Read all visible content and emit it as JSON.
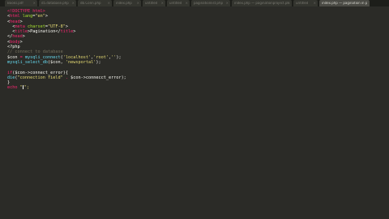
{
  "tabs": [
    {
      "label": "Books.pdf",
      "width": 40,
      "active": false
    },
    {
      "label": "d5.database.php",
      "width": 46,
      "active": false
    },
    {
      "label": "db.Conn.php",
      "width": 42,
      "active": false
    },
    {
      "label": "index.php",
      "width": 34,
      "active": false
    },
    {
      "label": "untitled",
      "width": 28,
      "active": false
    },
    {
      "label": "untitled",
      "width": 28,
      "active": false
    },
    {
      "label": "paginationlist.php",
      "width": 48,
      "active": false
    },
    {
      "label": "index.php — paginationproject.php",
      "width": 74,
      "active": false
    },
    {
      "label": "untitled",
      "width": 30,
      "active": false
    },
    {
      "label": "index.php — pagination in php",
      "width": 62,
      "active": true
    }
  ],
  "code": [
    {
      "l1": "<!DOCTYPE html>"
    },
    {
      "l2a": "<",
      "l2b": "html",
      "l2c": " lang",
      "l2d": "=",
      "l2e": "\"en\"",
      "l2f": ">"
    },
    {
      "l3a": "<",
      "l3b": "head",
      "l3c": ">"
    },
    {
      "l4a": "  <",
      "l4b": "meta",
      "l4c": " charset",
      "l4d": "=",
      "l4e": "\"UTF-8\"",
      "l4f": ">"
    },
    {
      "l5a": "  <",
      "l5b": "title",
      "l5c": ">",
      "l5d": "Pagination",
      "l5e": "</",
      "l5f": "title",
      "l5g": ">"
    },
    {
      "l6a": "</",
      "l6b": "head",
      "l6c": ">"
    },
    {
      "l7a": "<",
      "l7b": "body",
      "l7c": ">"
    },
    {
      "l8": "<?php"
    },
    {
      "l9": "// connect to database"
    },
    {
      "l10a": "$con",
      "l10b": " = ",
      "l10c": "mysqli_connect",
      "l10d": "(",
      "l10e": "'localhost'",
      "l10f": ",",
      "l10g": "'root'",
      "l10h": ",",
      "l10i": "''",
      "l10j": ");"
    },
    {
      "l11a": "mysqli_select_db",
      "l11b": "($con, ",
      "l11c": "'newsportal'",
      "l11d": ");"
    },
    {
      "l12": ""
    },
    {
      "l13a": "if",
      "l13b": "($con->connect_error){"
    },
    {
      "l14a": "die",
      "l14b": "(",
      "l14c": "\"connection field\"",
      "l14d": " . ",
      "l14e": "$con->connecct_error",
      "l14f": ");"
    },
    {
      "l15": "}"
    },
    {
      "l16a": "echo",
      "l16b": " \"",
      "l16c": "\";"
    }
  ]
}
